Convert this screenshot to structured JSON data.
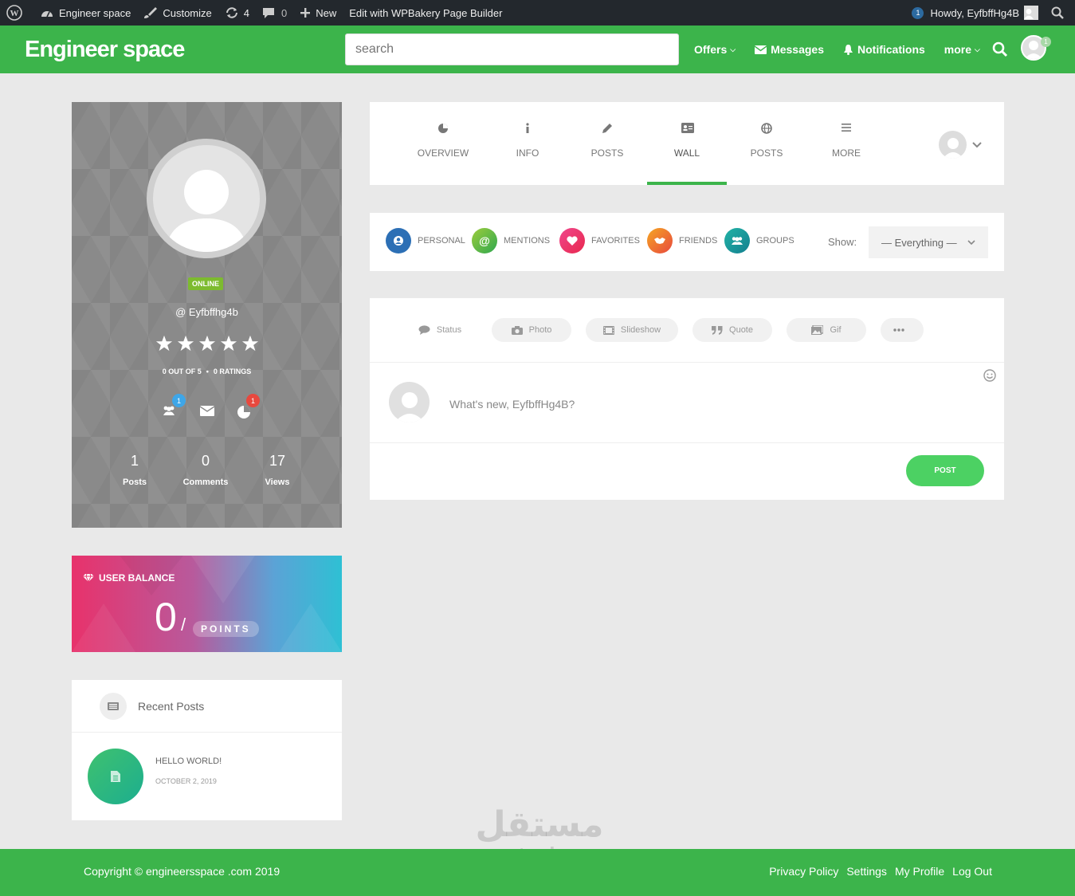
{
  "admin_bar": {
    "site_name": "Engineer space",
    "customize": "Customize",
    "updates_count": "4",
    "comments_count": "0",
    "new_label": "New",
    "builder_label": "Edit with WPBakery Page Builder",
    "notif_count": "1",
    "howdy": "Howdy, EyfbffHg4B"
  },
  "header": {
    "logo": "Engineer space",
    "search_placeholder": "search",
    "nav": {
      "offers": "Offers",
      "messages": "Messages",
      "notifications": "Notifications",
      "more": "more"
    },
    "avatar_badge": "1"
  },
  "profile": {
    "status": "ONLINE",
    "username": "@ Eyfbffhg4b",
    "rating_text": "0 OUT OF 5",
    "ratings_count": "0 RATINGS",
    "friends_badge": "1",
    "activity_badge": "1",
    "stats": [
      {
        "value": "1",
        "label": "Posts"
      },
      {
        "value": "0",
        "label": "Comments"
      },
      {
        "value": "17",
        "label": "Views"
      }
    ]
  },
  "balance": {
    "title": "USER BALANCE",
    "value": "0",
    "slash": "/",
    "unit": "POINTS"
  },
  "recent_posts": {
    "title": "Recent Posts",
    "items": [
      {
        "title": "HELLO WORLD!",
        "date": "OCTOBER 2, 2019"
      }
    ]
  },
  "tabs": [
    {
      "label": "OVERVIEW",
      "icon": "pie-chart-icon"
    },
    {
      "label": "INFO",
      "icon": "info-icon"
    },
    {
      "label": "POSTS",
      "icon": "pencil-icon"
    },
    {
      "label": "WALL",
      "icon": "id-card-icon",
      "active": true
    },
    {
      "label": "POSTS",
      "icon": "globe-icon"
    },
    {
      "label": "MORE",
      "icon": "menu-icon"
    }
  ],
  "filters": {
    "items": [
      {
        "label": "PERSONAL",
        "color": "#2c6fb5"
      },
      {
        "label": "MENTIONS",
        "color": "#6bbf3a"
      },
      {
        "label": "FAVORITES",
        "color": "#e8326b"
      },
      {
        "label": "FRIENDS",
        "color": "#f07b3c"
      },
      {
        "label": "GROUPS",
        "color": "#1a9fa0"
      }
    ],
    "show_label": "Show:",
    "show_value": "— Everything —"
  },
  "composer": {
    "types": [
      "Status",
      "Photo",
      "Slideshow",
      "Quote",
      "Gif"
    ],
    "placeholder": "What's new, EyfbffHg4B?",
    "post_button": "POST"
  },
  "footer": {
    "copyright": "Copyright © engineersspace .com 2019",
    "links": [
      "Privacy Policy",
      "Settings",
      "My Profile",
      "Log Out"
    ]
  },
  "watermark": {
    "arabic": "مستقل",
    "latin": "mostaql.com"
  },
  "colors": {
    "brand_green": "#3cb44b",
    "admin_bar": "#23282d",
    "post_button": "#4cd163"
  }
}
